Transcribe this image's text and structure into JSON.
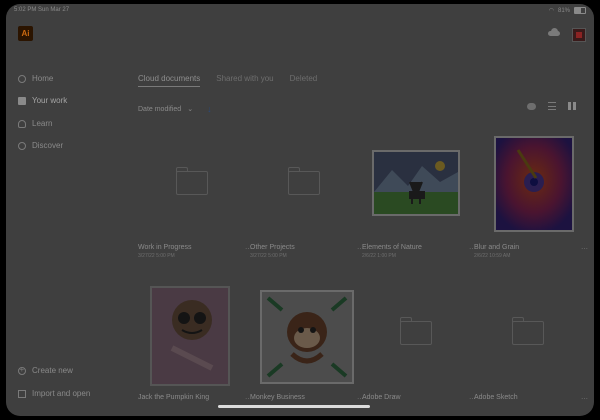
{
  "status": {
    "time": "5:02 PM",
    "date": "Sun Mar 27",
    "battery": "81%"
  },
  "app": {
    "logo": "Ai",
    "icons": [
      "cloud-icon",
      "avatar"
    ]
  },
  "sidebar": {
    "items": [
      {
        "label": "Home",
        "icon": "home-icon"
      },
      {
        "label": "Your work",
        "icon": "folder-icon",
        "active": true
      },
      {
        "label": "Learn",
        "icon": "learn-icon"
      },
      {
        "label": "Discover",
        "icon": "discover-icon"
      }
    ],
    "bottom": [
      {
        "label": "Create new",
        "icon": "plus-icon"
      },
      {
        "label": "Import and open",
        "icon": "import-icon"
      }
    ]
  },
  "tabs": [
    {
      "label": "Cloud documents",
      "active": true
    },
    {
      "label": "Shared with you"
    },
    {
      "label": "Deleted"
    }
  ],
  "sort": {
    "label": "Date modified"
  },
  "documents": [
    {
      "name": "Work in Progress",
      "date": "3/27/22 5:00 PM",
      "kind": "folder"
    },
    {
      "name": "Other Projects",
      "date": "3/27/22 5:00 PM",
      "kind": "folder"
    },
    {
      "name": "Elements of Nature",
      "date": "2/6/22 1:00 PM",
      "kind": "art"
    },
    {
      "name": "Blur and Grain",
      "date": "2/6/22 10:59 AM",
      "kind": "art"
    },
    {
      "name": "Jack the Pumpkin King",
      "date": "",
      "kind": "art"
    },
    {
      "name": "Monkey Business",
      "date": "",
      "kind": "art"
    },
    {
      "name": "Adobe Draw",
      "date": "",
      "kind": "folder"
    },
    {
      "name": "Adobe Sketch",
      "date": "",
      "kind": "folder"
    }
  ],
  "colors": {
    "bg": "#3f3f3f",
    "accent": "#2b4a7a"
  }
}
